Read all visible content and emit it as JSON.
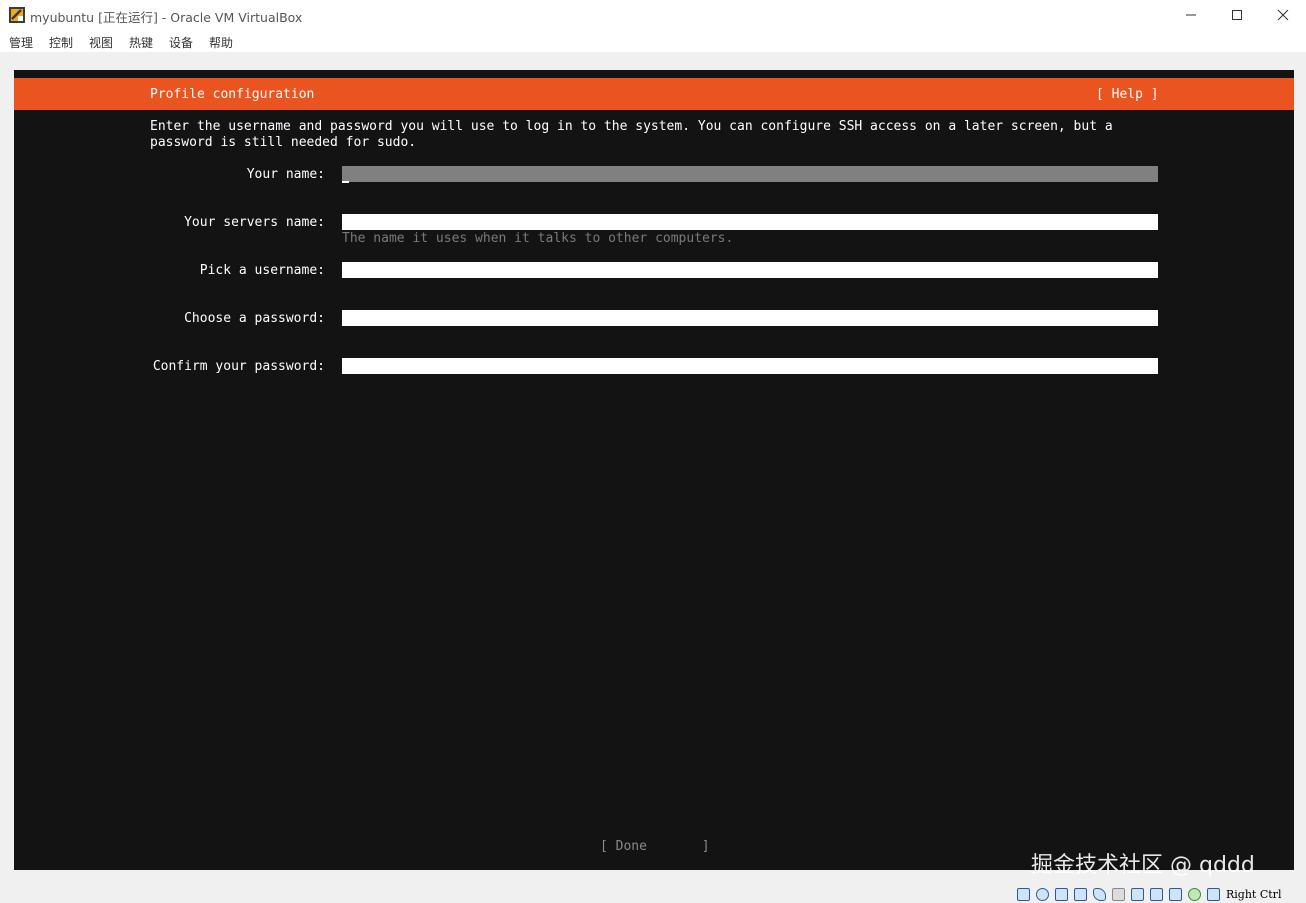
{
  "window": {
    "title": "myubuntu [正在运行] - Oracle VM VirtualBox",
    "minimize_icon": "minimize-icon",
    "maximize_icon": "maximize-icon",
    "close_icon": "close-icon"
  },
  "menubar": {
    "items": [
      "管理",
      "控制",
      "视图",
      "热键",
      "设备",
      "帮助"
    ]
  },
  "installer": {
    "header_title": "Profile configuration",
    "help_label": "[ Help ]",
    "accent_color": "#e95420",
    "description": "Enter the username and password you will use to log in to the system. You can configure SSH access on a later screen, but a password is still needed for sudo.",
    "fields": [
      {
        "label": "Your name:",
        "value": ""
      },
      {
        "label": "Your servers name:",
        "value": "",
        "hint": "The name it uses when it talks to other computers."
      },
      {
        "label": "Pick a username:",
        "value": ""
      },
      {
        "label": "Choose a password:",
        "value": ""
      },
      {
        "label": "Confirm your password:",
        "value": ""
      }
    ],
    "done_label": "[ Done       ]"
  },
  "watermark": "掘金技术社区 @ qddd",
  "statusbar": {
    "icons": [
      "hard-disk-icon",
      "optical-drive-icon",
      "audio-icon",
      "network-icon",
      "usb-icon",
      "shared-folder-icon",
      "display-icon",
      "recording-icon",
      "cpu-icon",
      "mouse-integration-icon",
      "keyboard-icon"
    ],
    "host_key": "Right Ctrl"
  }
}
